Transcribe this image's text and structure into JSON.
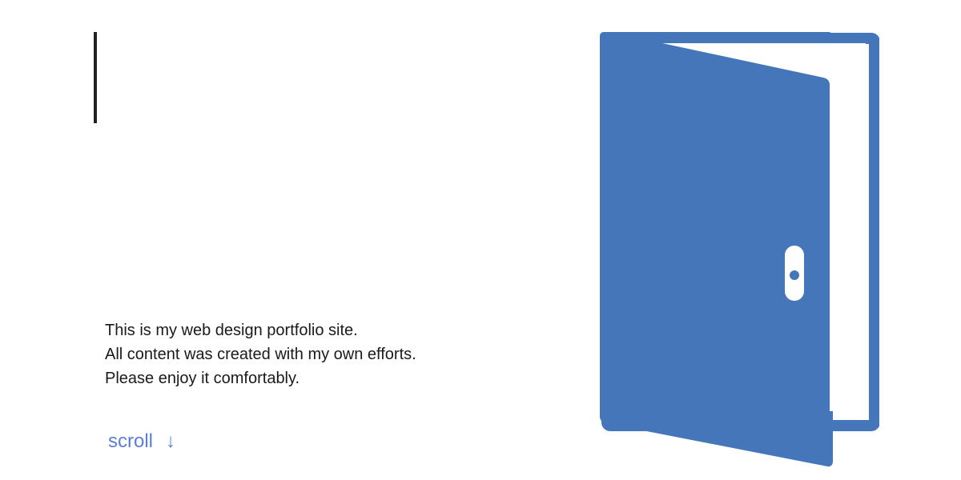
{
  "intro": {
    "lines": [
      "This is my web design portfolio site.",
      "All content was created with my own efforts.",
      "Please enjoy it comfortably."
    ]
  },
  "scroll": {
    "label": "scroll",
    "arrow": "↓"
  },
  "colors": {
    "door": "#4676ba",
    "accent": "#5b7fd6",
    "text": "#1a1a1a",
    "bar": "#222222"
  },
  "icons": {
    "hero": "open-door-icon"
  }
}
